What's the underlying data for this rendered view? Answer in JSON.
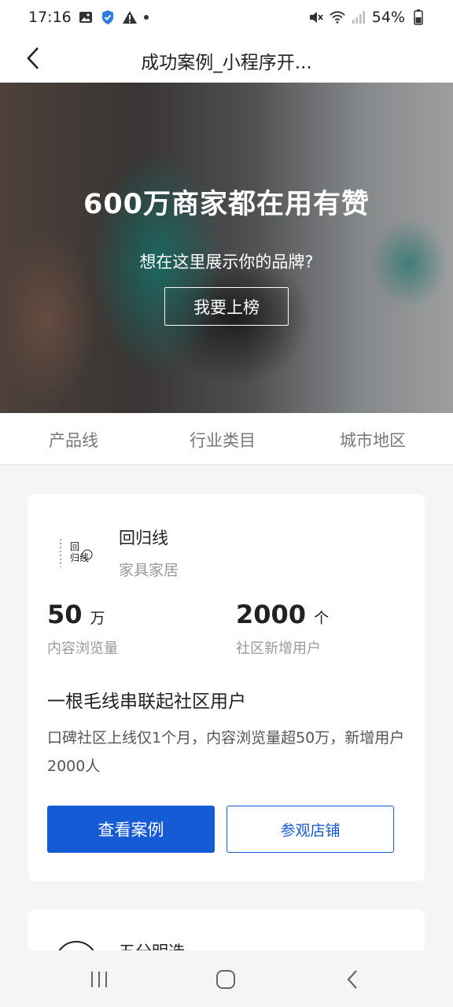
{
  "status_bar": {
    "time": "17:16",
    "battery": "54%",
    "left_icons": [
      "image-icon",
      "shield-check-icon",
      "warning-icon",
      "dot-icon"
    ],
    "right_icons": [
      "mute-icon",
      "wifi-icon",
      "signal-icon",
      "battery-icon"
    ]
  },
  "nav": {
    "title": "成功案例_小程序开..."
  },
  "banner": {
    "title": "600万商家都在用有赞",
    "subtitle": "想在这里展示你的品牌?",
    "button_label": "我要上榜"
  },
  "filters": {
    "tabs": [
      "产品线",
      "行业类目",
      "城市地区"
    ]
  },
  "cases": [
    {
      "brand_name": "回归线",
      "category": "家具家居",
      "logo_text": "回归线",
      "metrics": [
        {
          "value": "50",
          "unit": "万",
          "label": "内容浏览量"
        },
        {
          "value": "2000",
          "unit": "个",
          "label": "社区新增用户"
        }
      ],
      "headline": "一根毛线串联起社区用户",
      "description": "口碑社区上线仅1个月，内容浏览量超50万，新增用户2000人",
      "primary_button": "查看案例",
      "secondary_button": "参观店铺"
    },
    {
      "brand_name": "五分明选"
    }
  ],
  "colors": {
    "accent": "#155bd5",
    "muted_text": "#999999"
  }
}
